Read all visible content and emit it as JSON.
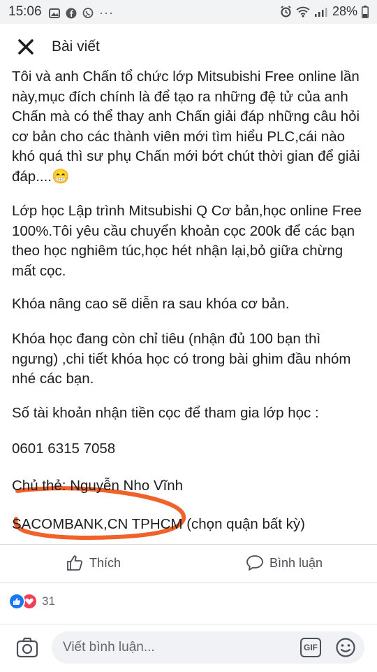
{
  "status": {
    "time": "15:06",
    "battery": "28%"
  },
  "header": {
    "title": "Bài viết"
  },
  "post": {
    "p1": [
      "Tôi và anh Chấn tổ chức lớp Mitsubishi Free online lần",
      "này,mục đích chính là để tạo ra những đệ tử của anh",
      "Chấn mà có thể thay anh Chấn giải đáp những câu hỏi",
      "cơ bản cho các thành viên mới tìm hiểu PLC,cái nào",
      "khó quá thì sư phụ Chấn mới bớt chút thời gian để giải",
      "đáp....😁"
    ],
    "p2": [
      "Lớp học Lập trình Mitsubishi Q Cơ bản,học online Free",
      "100%.Tôi yêu cầu chuyển khoản cọc 200k để các bạn",
      "theo học nghiêm túc,học hét nhận lại,bỏ giữa chừng",
      "mất cọc."
    ],
    "p3": "Khóa nâng cao sẽ diễn ra sau khóa cơ bản.",
    "p4": [
      "Khóa học đang còn chỉ tiêu (nhận đủ 100 bạn thì",
      "ngưng) ,chi tiết khóa học có trong bài ghim đầu nhóm",
      "nhé các bạn."
    ],
    "p5": "Số tài khoản nhận tiền cọc để tham gia lớp học :",
    "account": "0601 6315 7058",
    "holder": "Chủ thẻ: Nguyễn Nho Vĩnh",
    "bank": "SACOMBANK,CN TPHCM (chọn quận bất kỳ)"
  },
  "actions": {
    "like": "Thích",
    "comment": "Bình luận"
  },
  "reactions": {
    "count": "31"
  },
  "composer": {
    "placeholder": "Viết bình luận...",
    "gif": "GIF"
  },
  "colors": {
    "annotation": "#f0622a",
    "like_blue": "#1877f2",
    "love_red": "#f33e58"
  }
}
